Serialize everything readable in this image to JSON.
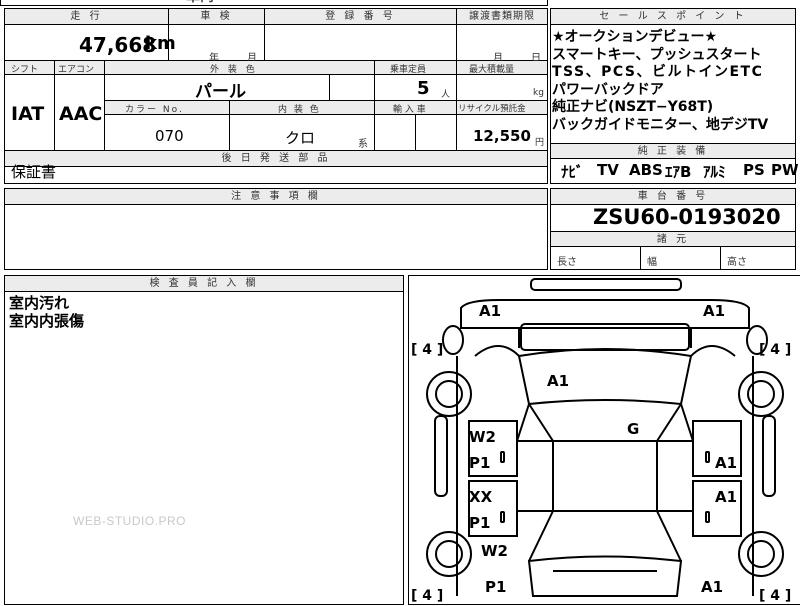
{
  "top_partial": "車両",
  "headers": {
    "mileage": "走 行",
    "inspection": "車 検",
    "registration": "登 録 番 号",
    "transfer_deadline": "譲渡書類期限",
    "shift": "シフト",
    "aircon": "エアコン",
    "exterior_color": "外 装 色",
    "capacity": "乗車定員",
    "max_load": "最大積載量",
    "color_no": "カラー No.",
    "interior_color": "内 装 色",
    "import": "輸 入 車",
    "recycle": "リサイクル預託金",
    "later_parts": "後 日 発 送 部 品",
    "notes": "注 意 事 項 欄",
    "inspector": "検 査 員 記 入 欄",
    "sales_points": "セ ー ル ス ポ イ ン ト",
    "genuine_equipment": "純 正 装 備",
    "chassis_no": "車 台 番 号",
    "dimensions": "諸 元"
  },
  "values": {
    "mileage": "47,668",
    "mileage_unit": "km",
    "inspection_year": "年",
    "inspection_month": "月",
    "transfer_month": "月",
    "transfer_day": "日",
    "shift": "IAT",
    "aircon": "AAC",
    "exterior_color": "パール",
    "capacity": "5",
    "capacity_unit": "人",
    "max_load_unit": "kg",
    "color_no": "070",
    "interior_color": "クロ",
    "interior_suffix": "系",
    "recycle": "12,550",
    "recycle_unit": "円",
    "later_parts": "保証書",
    "chassis_no": "ZSU60-0193020"
  },
  "sales_points": [
    "★オークションデビュー★",
    "スマートキー、プッシュスタート",
    "TSS、PCS、ビルトインETC",
    "パワーバックドア",
    "純正ナビ(NSZT−Y68T)",
    "バックガイドモニター、地デジTV"
  ],
  "equipment": [
    "ﾅﾋﾞ",
    "TV",
    "ABS",
    "ｴｱB",
    "ｱﾙﾐ",
    "PS",
    "PW"
  ],
  "dimension_labels": [
    "長さ",
    "幅",
    "高さ"
  ],
  "inspector_notes": [
    "室内汚れ",
    "室内内張傷"
  ],
  "watermark": "WEB-STUDIO.PRO",
  "diagram": {
    "marks": [
      "A1",
      "A1",
      "A1",
      "G",
      "W2",
      "P1",
      "A1",
      "XX",
      "P1",
      "A1",
      "W2",
      "P1",
      "A1"
    ],
    "tires": [
      "[ 4 ]",
      "[ 4 ]",
      "[ 4 ]",
      "[ 4 ]"
    ]
  }
}
